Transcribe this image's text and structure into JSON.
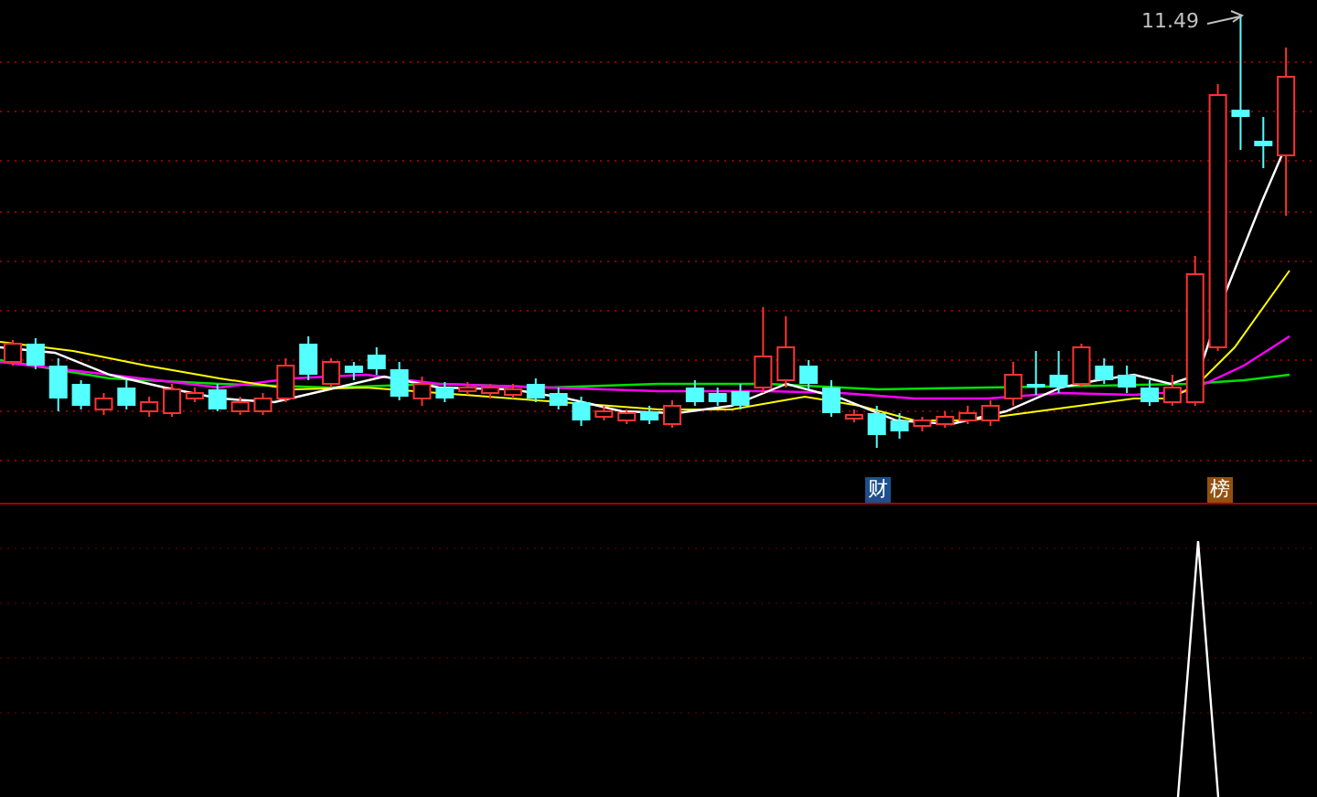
{
  "price_chart": {
    "high_label": "11.49",
    "event_markers": [
      {
        "text": "财",
        "color": "#1c4f8c"
      },
      {
        "text": "榜",
        "color": "#94500f"
      }
    ]
  }
}
